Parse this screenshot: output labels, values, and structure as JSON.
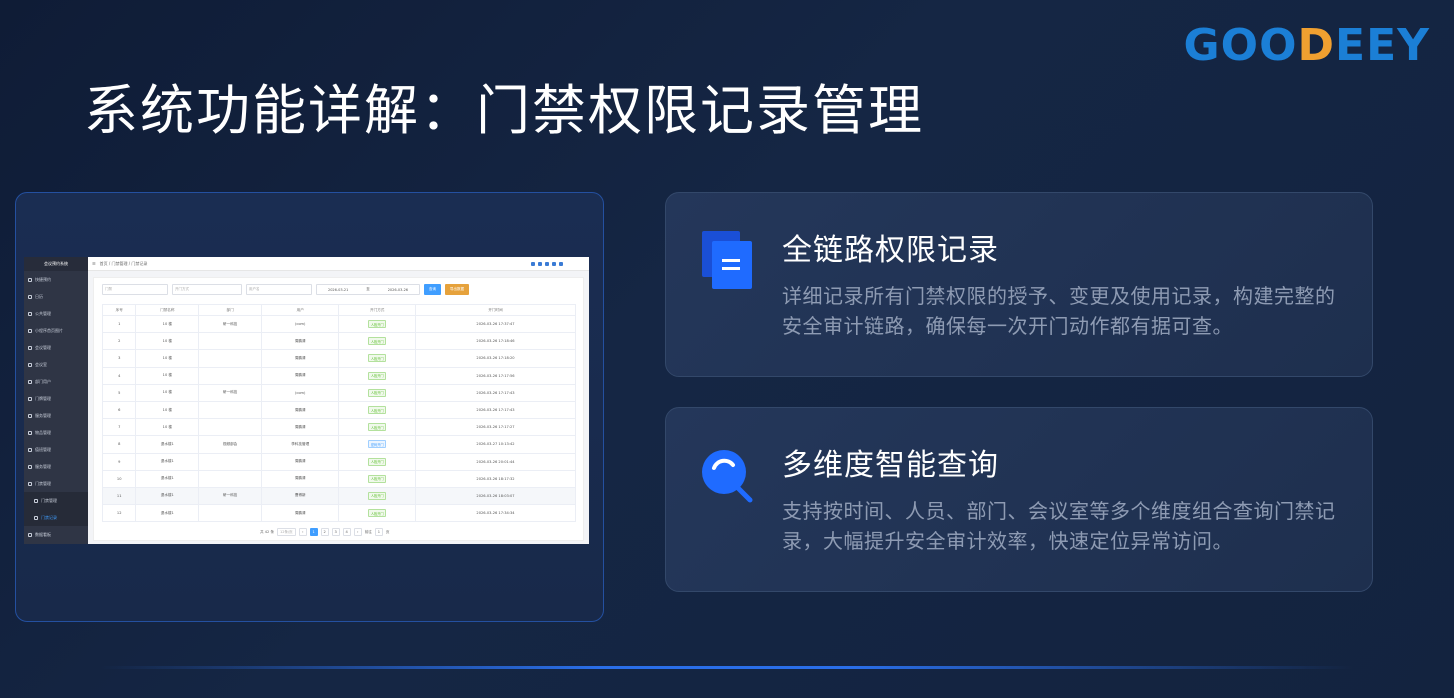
{
  "brand": {
    "logo_part1": "GOO",
    "logo_part2": "D",
    "logo_part3": "EEY"
  },
  "slide_title": "系统功能详解：门禁权限记录管理",
  "features": [
    {
      "icon": "document-icon",
      "title": "全链路权限记录",
      "desc": "详细记录所有门禁权限的授予、变更及使用记录，构建完整的安全审计链路，确保每一次开门动作都有据可查。"
    },
    {
      "icon": "search-icon",
      "title": "多维度智能查询",
      "desc": "支持按时间、人员、部门、会议室等多个维度组合查询门禁记录，大幅提升安全审计效率，快速定位异常访问。"
    }
  ],
  "screenshot": {
    "side_title": "会议预约系统",
    "side_items": [
      "快捷预约",
      "日历",
      "公共管理",
      "小程序首页图片",
      "会议管理",
      "会议室",
      "部门用户",
      "门牌管理",
      "服务管理",
      "物品管理",
      "值班管理",
      "服务管理",
      "门禁管理",
      "门禁管理",
      "门禁记录",
      "数据看板"
    ],
    "breadcrumb": "首页 / 门禁管理 / 门禁记录",
    "filters": [
      "门禁",
      "开门方式",
      "用户名",
      "2026-03-21",
      "至",
      "2026-03-26"
    ],
    "buttons": {
      "query": "查询",
      "export": "导出数据"
    },
    "columns": [
      "序号",
      "门禁名称",
      "部门",
      "用户",
      "开门方式",
      "开门时间"
    ],
    "rows": [
      [
        "1",
        "10 楼",
        "研一科技",
        "(com)",
        "人脸开门",
        "2026-03-26 17:37:47"
      ],
      [
        "2",
        "10 楼",
        "",
        "周鹏清",
        "人脸开门",
        "2026-03-26 17:18:46"
      ],
      [
        "3",
        "10 楼",
        "",
        "周鹏清",
        "人脸开门",
        "2026-03-26 17:18:20"
      ],
      [
        "4",
        "10 楼",
        "",
        "周鹏清",
        "人脸开门",
        "2026-03-26 17:17:56"
      ],
      [
        "5",
        "10 楼",
        "研一科技",
        "(com)",
        "人脸开门",
        "2026-03-26 17:17:43"
      ],
      [
        "6",
        "10 楼",
        "",
        "周鹏清",
        "人脸开门",
        "2026-03-26 17:17:43"
      ],
      [
        "7",
        "10 楼",
        "",
        "周鹏清",
        "人脸开门",
        "2026-03-26 17:17:27"
      ],
      [
        "8",
        "退水楼1",
        "视频部会",
        "李科技管理",
        "密码开门",
        "2026-03-27 10:13:42"
      ],
      [
        "9",
        "退水楼1",
        "",
        "周鹏清",
        "人脸开门",
        "2026-03-26 20:01:44"
      ],
      [
        "10",
        "退水楼1",
        "",
        "周鹏清",
        "人脸开门",
        "2026-03-26 18:17:32"
      ],
      [
        "11",
        "退水楼1",
        "研一科技",
        "曹博新",
        "人脸开门",
        "2026-03-26 18:03:07"
      ],
      [
        "12",
        "退水楼1",
        "",
        "周鹏清",
        "人脸开门",
        "2026-03-26 17:34:34"
      ]
    ],
    "pager": {
      "total": "共 42 条",
      "size": "12条/页",
      "pages": [
        "1",
        "2",
        "3",
        "4"
      ],
      "goto": "前往",
      "page": "1",
      "unit": "页"
    }
  },
  "colors": {
    "accent": "#2a6ee8",
    "logo_blue": "#1b7fd6",
    "logo_orange": "#f0a030"
  }
}
